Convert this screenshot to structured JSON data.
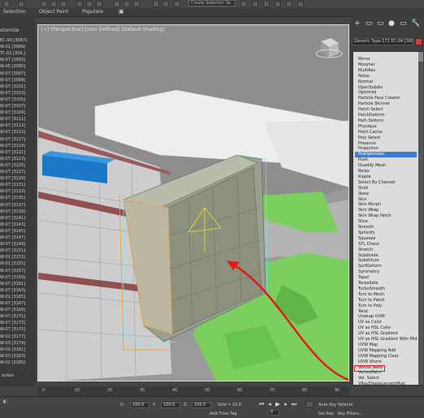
{
  "toolbar": {
    "dropdown_value": "Create Selection Se..."
  },
  "ribbon": {
    "tabs": [
      "Selection",
      "Object Paint",
      "Populate"
    ]
  },
  "left_panel": {
    "header": "stomize",
    "items": [
      "EC-04 [3087]",
      "W-01 [3089]",
      "TC-02 [309.]",
      "W-07 [3093]",
      "W-05 [3095]",
      "W-07 [3097]",
      "W-07 [3099]",
      "W-07 [3101]",
      "W-07 [3103]",
      "W-07 [3105]",
      "W-07 [3107]",
      "W-07 [3109]",
      "W-07 [3111]",
      "W-07 [3113]",
      "W-07 [3115]",
      "W-07 [3117]",
      "W-07 [3119]",
      "W-07 [3121]",
      "W-07 [3123]",
      "W-07 [3125]",
      "W-07 [3127]",
      "W-07 [3129]",
      "W-07 [3131]",
      "W-07 [3133]",
      "W-07 [3135]",
      "W-07 [3137]",
      "W-07 [3139]",
      "W-07 [3141]",
      "W-07 [3143]",
      "W-07 [3145]",
      "W-07 [3147]",
      "W-07 [3149]",
      "W-07 [3151]",
      "W-01 [3153]",
      "W-01 [3155]",
      "W-07 [3157]",
      "W-07 [3159]",
      "W-07 [3161]",
      "W-07 [3163]",
      "W-01 [3165]",
      "W-07 [3167]",
      "W-07 [3169]",
      "W-07 [3171]",
      "W-07 [3173]",
      "W-07 [3175]",
      "W-02 [3177]",
      "W-03 [3179]",
      "W-02 [3181]",
      "W-03 [3183]",
      "W-02 [3185]"
    ],
    "bottom_label": "ection"
  },
  "viewport": {
    "label": "[+] [Perspective] [User Defined] [Default Shading]"
  },
  "command_panel": {
    "tabs": [
      "+",
      "▭",
      "▭",
      "●",
      "▭",
      "🔧"
    ],
    "object_name": "Generic Type-171 EC-04 [3087]",
    "object_color": "#c84646",
    "modifiers": [
      "Mirror",
      "Morpher",
      "MultiRes",
      "Noise",
      "Normal",
      "OpenSubdiv",
      "Optimize",
      "Particle Face Creator",
      "Particle Skinner",
      "Patch Select",
      "PatchDeform",
      "Path Deform",
      "Physique",
      "Point Cache",
      "Poly Select",
      "Preserve",
      "Projection",
      "ProOptimizer",
      "Push",
      "Quadify Mesh",
      "Relax",
      "Ripple",
      "Select By Channel",
      "Shell",
      "Skew",
      "Skin",
      "Skin Morph",
      "Skin Wrap",
      "Skin Wrap Patch",
      "Slice",
      "Smooth",
      "Spherify",
      "Squeeze",
      "STL Check",
      "Stretch",
      "Subdivide",
      "Substitute",
      "SurfDeform",
      "Symmetry",
      "Taper",
      "Tessellate",
      "TurboSmooth",
      "Turn to Mesh",
      "Turn to Patch",
      "Turn to Poly",
      "Twist",
      "Unwrap UVW",
      "UV as Color",
      "UV as HSL Color",
      "UV as HSL Gradient",
      "UV as HSL Gradient With Midpoint",
      "UVW Map",
      "UVW Mapping Add",
      "UVW Mapping Clear",
      "UVW Xform",
      "Vertex Weld",
      "VertexPaint",
      "Vol. Select",
      "VRayDisplacementMod"
    ],
    "selected_index": 17,
    "annotated_index": 51
  },
  "timeline": {
    "ticks": [
      "0",
      "10",
      "20",
      "30",
      "40",
      "50",
      "60",
      "70",
      "80",
      "90"
    ]
  },
  "status": {
    "x_label": "X:",
    "x_value": "100.0",
    "y_label": "Y:",
    "y_value": "100.0",
    "z_label": "Z:",
    "z_value": "100.0",
    "grid": "Grid = 10.0",
    "add_time_tag": "Add Time Tag",
    "auto_key": "Auto Key",
    "set_key": "Set Key",
    "selected": "Selecte",
    "frame_value": "0",
    "key_filters": "Key Filters..."
  },
  "colors": {
    "annotation_red": "#e01b1b",
    "selection_blue": "#3a7bd5",
    "grass_green": "#7ccf5e"
  }
}
